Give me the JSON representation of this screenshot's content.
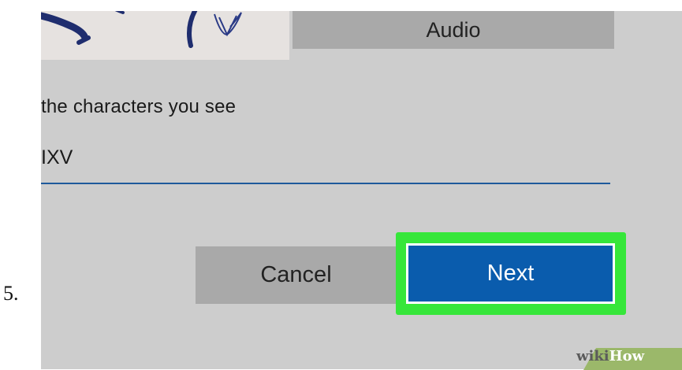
{
  "step_number": "5.",
  "captcha": {
    "partial_input": "IXV"
  },
  "audio_button": {
    "label": "Audio"
  },
  "prompt": {
    "text": "the characters you see"
  },
  "cancel_button": {
    "label": "Cancel"
  },
  "next_button": {
    "label": "Next"
  },
  "colors": {
    "next_background": "#0a5cad",
    "highlight": "#36e63a",
    "gray_button": "#a9a9a9",
    "input_underline": "#1e5a9c"
  },
  "watermark": {
    "part1": "wiki",
    "part2": "How"
  }
}
